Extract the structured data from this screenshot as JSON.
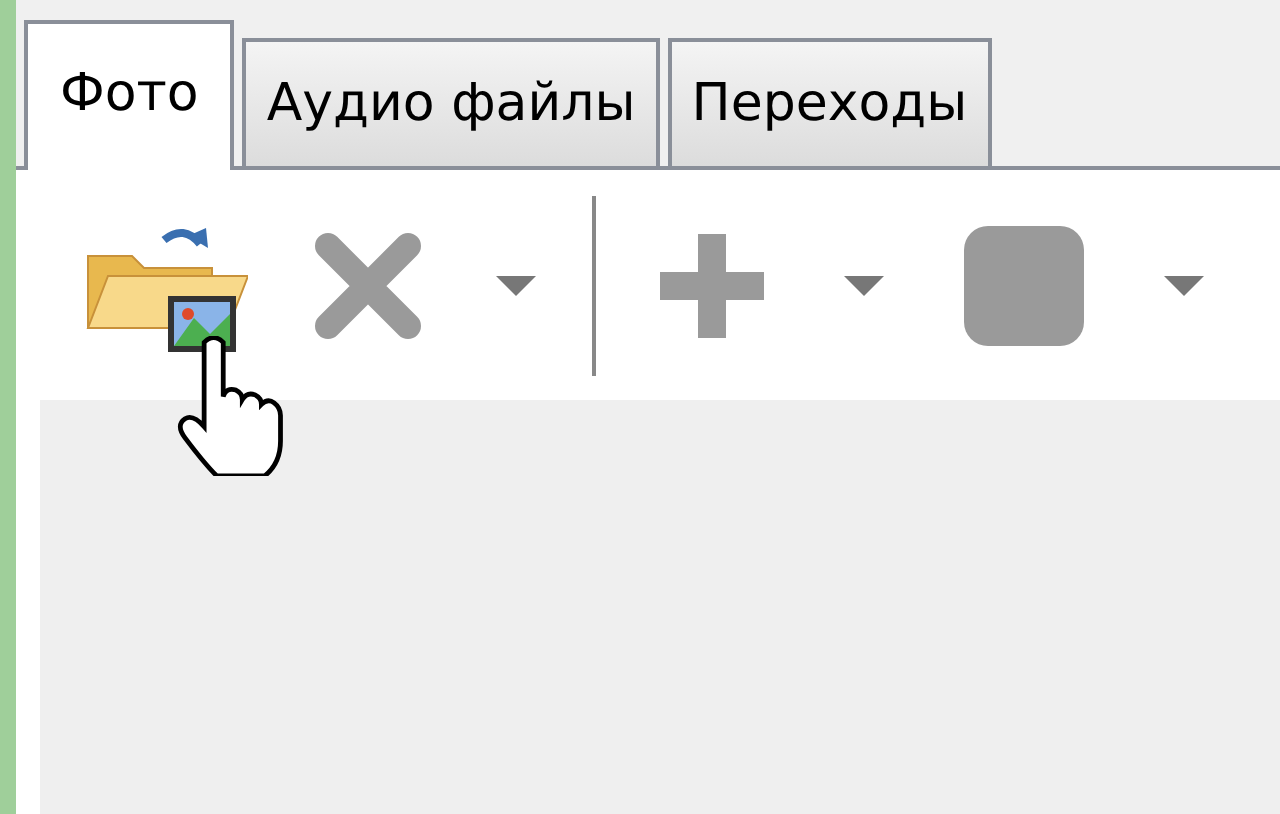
{
  "tabs": [
    {
      "label": "Фото",
      "selected": true
    },
    {
      "label": "Аудио файлы",
      "selected": false
    },
    {
      "label": "Переходы",
      "selected": false
    }
  ],
  "toolbar": [
    {
      "kind": "open",
      "disabled": false,
      "dropdown": false
    },
    {
      "kind": "delete",
      "disabled": true,
      "dropdown": true
    },
    {
      "kind": "separator"
    },
    {
      "kind": "add",
      "disabled": true,
      "dropdown": true
    },
    {
      "kind": "stop",
      "disabled": true,
      "dropdown": true
    }
  ]
}
